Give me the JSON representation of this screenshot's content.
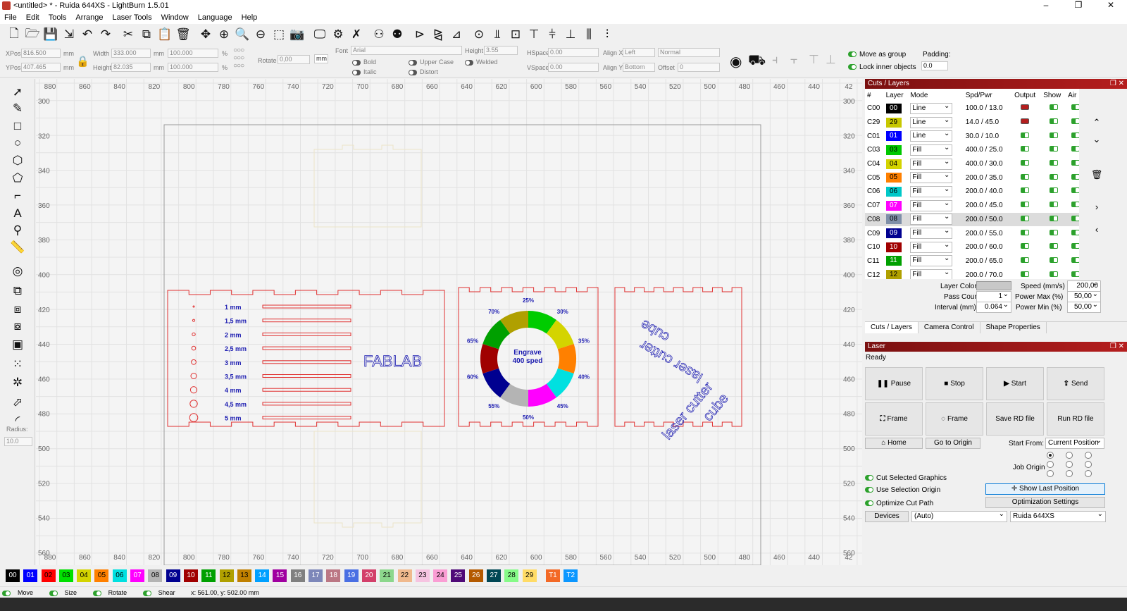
{
  "window": {
    "title": "<untitled> * - Ruida 644XS - LightBurn 1.5.01",
    "minimize": "–",
    "maximize": "❐",
    "close": "✕"
  },
  "menu": [
    "File",
    "Edit",
    "Tools",
    "Arrange",
    "Laser Tools",
    "Window",
    "Language",
    "Help"
  ],
  "toolbar_icons": [
    "new-file-icon",
    "open-folder-icon",
    "save-icon",
    "import-icon",
    "undo-icon",
    "redo-icon",
    "cut-icon",
    "copy-icon",
    "paste-icon",
    "delete-icon",
    "move-icon",
    "zoom-to-page-icon",
    "zoom-in-icon",
    "zoom-out-icon",
    "zoom-to-selection-icon",
    "camera-icon",
    "monitor-icon",
    "settings-icon",
    "machine-settings-icon",
    "group-icon",
    "ungroup-icon",
    "flip-horizontal-icon",
    "mirror-icon",
    "flip-icon",
    "center-icon",
    "align-icon",
    "distribute-icon",
    "align-top-icon",
    "align-middle-icon",
    "align-bottom-icon",
    "distribute-h-icon",
    "distribute-v-icon"
  ],
  "props": {
    "xpos_label": "XPos",
    "xpos": "816.500",
    "ypos_label": "YPos",
    "ypos": "407.465",
    "unit": "mm",
    "width_label": "Width",
    "width": "333.000",
    "height_label": "Height",
    "height": "82.035",
    "w_pct": "100.000",
    "h_pct": "100.000",
    "pct": "%",
    "rotate_label": "Rotate",
    "rotate": "0,00",
    "mm_btn": "mm",
    "font_label": "Font",
    "font": "Arial",
    "fheight_label": "Height",
    "fheight": "3.55",
    "hspace_label": "HSpace",
    "hspace": "0.00",
    "vspace_label": "VSpace",
    "vspace": "0.00",
    "alignx_label": "Align X",
    "alignx": "Left",
    "aligny_label": "Align Y",
    "aligny": "Bottom",
    "normal": "Normal",
    "offset_label": "Offset",
    "offset": "0",
    "bold": "Bold",
    "italic": "Italic",
    "upper": "Upper Case",
    "welded": "Welded",
    "distort": "Distort",
    "move_group": "Move as group",
    "lock_inner": "Lock inner objects",
    "padding_label": "Padding:",
    "padding": "0.0"
  },
  "left_tools": [
    "select-tool-icon",
    "draw-lines-icon",
    "rectangle-icon",
    "ellipse-icon",
    "polygon-icon",
    "edit-nodes-icon",
    "position-icon",
    "text-icon",
    "marker-icon",
    "measure-icon",
    "offset-icon",
    "boolean-union-icon",
    "boolean-subtract-icon",
    "boolean-intersect-icon",
    "weld-icon",
    "grid-array-icon",
    "circular-array-icon",
    "break-apart-icon",
    "corner-icon"
  ],
  "radius_label": "Radius:",
  "radius": "10.0",
  "ruler": {
    "x_labels": [
      "880",
      "860",
      "840",
      "820",
      "800",
      "780",
      "760",
      "740",
      "720",
      "700",
      "680",
      "660",
      "640",
      "620",
      "600",
      "580",
      "560",
      "540",
      "520",
      "500",
      "480",
      "460",
      "440",
      "42"
    ],
    "y_labels": [
      "300",
      "320",
      "340",
      "360",
      "380",
      "400",
      "420",
      "440",
      "460",
      "480",
      "500",
      "520",
      "540",
      "560"
    ]
  },
  "canvas": {
    "holes": [
      "1 mm",
      "1,5 mm",
      "2 mm",
      "2,5 mm",
      "3 mm",
      "3,5 mm",
      "4 mm",
      "4,5 mm",
      "5 mm"
    ],
    "fablab": "FABLAB",
    "engrave": [
      "Engrave",
      "400 sped"
    ],
    "pcts": [
      "25%",
      "30%",
      "35%",
      "40%",
      "45%",
      "50%",
      "55%",
      "60%",
      "65%",
      "70%"
    ],
    "wheel_colors": [
      "#00cc00",
      "#d4d400",
      "#ff8000",
      "#00e0e0",
      "#ff00ff",
      "#b4b4b4",
      "#000090",
      "#a00000",
      "#00a000",
      "#b0a000"
    ],
    "text_lines": [
      "cube",
      "laser cutter",
      "laser cutter",
      "cube"
    ]
  },
  "layers": {
    "title": "Cuts / Layers",
    "headers": [
      "#",
      "Layer",
      "Mode",
      "Spd/Pwr",
      "Output",
      "Show",
      "Air"
    ],
    "rows": [
      {
        "id": "C00",
        "num": "00",
        "color": "#000000",
        "fg": "#fff",
        "mode": "Line",
        "sp": "100.0 / 13.0",
        "out": "r"
      },
      {
        "id": "C29",
        "num": "29",
        "color": "#c8c800",
        "fg": "#000",
        "mode": "Line",
        "sp": "14.0 / 45.0",
        "out": "r"
      },
      {
        "id": "C01",
        "num": "01",
        "color": "#0000ff",
        "fg": "#fff",
        "mode": "Line",
        "sp": "30.0 / 10.0",
        "out": "g"
      },
      {
        "id": "C03",
        "num": "03",
        "color": "#00c800",
        "fg": "#000",
        "mode": "Fill",
        "sp": "400.0 / 25.0",
        "out": "g"
      },
      {
        "id": "C04",
        "num": "04",
        "color": "#d4d400",
        "fg": "#000",
        "mode": "Fill",
        "sp": "400.0 / 30.0",
        "out": "g"
      },
      {
        "id": "C05",
        "num": "05",
        "color": "#ff8000",
        "fg": "#000",
        "mode": "Fill",
        "sp": "200.0 / 35.0",
        "out": "g"
      },
      {
        "id": "C06",
        "num": "06",
        "color": "#00c8c8",
        "fg": "#000",
        "mode": "Fill",
        "sp": "200.0 / 40.0",
        "out": "g"
      },
      {
        "id": "C07",
        "num": "07",
        "color": "#ff00ff",
        "fg": "#fff",
        "mode": "Fill",
        "sp": "200.0 / 45.0",
        "out": "g"
      },
      {
        "id": "C08",
        "num": "08",
        "color": "#7f8fa8",
        "fg": "#000",
        "mode": "Fill",
        "sp": "200.0 / 50.0",
        "out": "g"
      },
      {
        "id": "C09",
        "num": "09",
        "color": "#000090",
        "fg": "#fff",
        "mode": "Fill",
        "sp": "200.0 / 55.0",
        "out": "g"
      },
      {
        "id": "C10",
        "num": "10",
        "color": "#a00000",
        "fg": "#fff",
        "mode": "Fill",
        "sp": "200.0 / 60.0",
        "out": "g"
      },
      {
        "id": "C11",
        "num": "11",
        "color": "#00a000",
        "fg": "#fff",
        "mode": "Fill",
        "sp": "200.0 / 65.0",
        "out": "g"
      },
      {
        "id": "C12",
        "num": "12",
        "color": "#b0a000",
        "fg": "#000",
        "mode": "Fill",
        "sp": "200.0 / 70.0",
        "out": "g"
      }
    ],
    "selected": "C08",
    "layer_color_label": "Layer Color",
    "speed_label": "Speed (mm/s)",
    "speed": "200,00",
    "pass_label": "Pass Count",
    "pass": "1",
    "pmax_label": "Power Max (%)",
    "pmax": "50,00",
    "interval_label": "Interval (mm)",
    "interval": "0.064",
    "pmin_label": "Power Min (%)",
    "pmin": "50,00"
  },
  "tabs": [
    "Cuts / Layers",
    "Camera Control",
    "Shape Properties"
  ],
  "laser": {
    "title": "Laser",
    "status": "Ready",
    "pause": "Pause",
    "stop": "Stop",
    "start": "Start",
    "send": "Send",
    "frame1": "Frame",
    "frame2": "Frame",
    "save_rd": "Save RD file",
    "run_rd": "Run RD file",
    "home": "Home",
    "goto_origin": "Go to Origin",
    "start_from_label": "Start From:",
    "start_from": "Current Position",
    "job_origin": "Job Origin",
    "cut_selected": "Cut Selected Graphics",
    "use_sel_origin": "Use Selection Origin",
    "optimize": "Optimize Cut Path",
    "show_last": "Show Last Position",
    "opt_settings": "Optimization Settings",
    "devices": "Devices",
    "port": "(Auto)",
    "device": "Ruida 644XS"
  },
  "palette": [
    {
      "n": "00",
      "c": "#000000",
      "f": "#fff"
    },
    {
      "n": "01",
      "c": "#0000ff",
      "f": "#fff"
    },
    {
      "n": "02",
      "c": "#ff0000",
      "f": "#000"
    },
    {
      "n": "03",
      "c": "#00e000",
      "f": "#000"
    },
    {
      "n": "04",
      "c": "#d4d400",
      "f": "#000"
    },
    {
      "n": "05",
      "c": "#ff8000",
      "f": "#000"
    },
    {
      "n": "06",
      "c": "#00e0e0",
      "f": "#000"
    },
    {
      "n": "07",
      "c": "#ff00ff",
      "f": "#fff"
    },
    {
      "n": "08",
      "c": "#b4b4b4",
      "f": "#000"
    },
    {
      "n": "09",
      "c": "#000090",
      "f": "#fff"
    },
    {
      "n": "10",
      "c": "#a00000",
      "f": "#fff"
    },
    {
      "n": "11",
      "c": "#00a000",
      "f": "#fff"
    },
    {
      "n": "12",
      "c": "#b0a000",
      "f": "#000"
    },
    {
      "n": "13",
      "c": "#c08000",
      "f": "#000"
    },
    {
      "n": "14",
      "c": "#00a0ff",
      "f": "#fff"
    },
    {
      "n": "15",
      "c": "#a000a0",
      "f": "#fff"
    },
    {
      "n": "16",
      "c": "#808080",
      "f": "#fff"
    },
    {
      "n": "17",
      "c": "#7d87b9",
      "f": "#fff"
    },
    {
      "n": "18",
      "c": "#bb7784",
      "f": "#fff"
    },
    {
      "n": "19",
      "c": "#4a6fe3",
      "f": "#fff"
    },
    {
      "n": "20",
      "c": "#d33f6a",
      "f": "#fff"
    },
    {
      "n": "21",
      "c": "#8cd78c",
      "f": "#000"
    },
    {
      "n": "22",
      "c": "#f0b98d",
      "f": "#000"
    },
    {
      "n": "23",
      "c": "#f6c4e1",
      "f": "#000"
    },
    {
      "n": "24",
      "c": "#fa9ed4",
      "f": "#000"
    },
    {
      "n": "25",
      "c": "#500a78",
      "f": "#fff"
    },
    {
      "n": "26",
      "c": "#b45a00",
      "f": "#fff"
    },
    {
      "n": "27",
      "c": "#004754",
      "f": "#fff"
    },
    {
      "n": "28",
      "c": "#86fa88",
      "f": "#000"
    },
    {
      "n": "29",
      "c": "#ffdb66",
      "f": "#000"
    },
    {
      "n": "T1",
      "c": "#f36926",
      "f": "#fff"
    },
    {
      "n": "T2",
      "c": "#0c97ff",
      "f": "#fff"
    }
  ],
  "status": {
    "move": "Move",
    "size": "Size",
    "rotate": "Rotate",
    "shear": "Shear",
    "coords": "x: 561.00, y: 502.00 mm"
  }
}
